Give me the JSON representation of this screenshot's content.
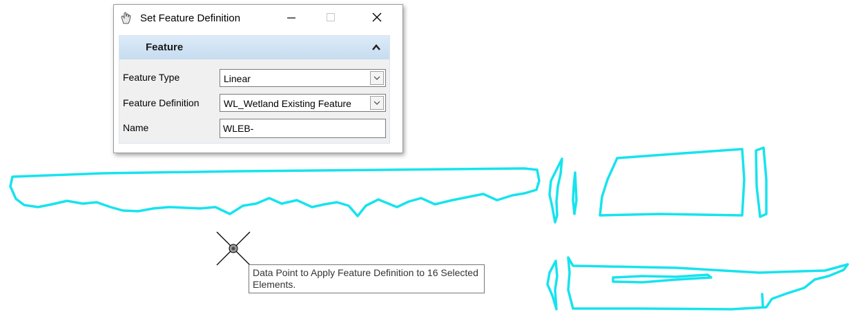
{
  "dialog": {
    "title": "Set Feature Definition",
    "window_buttons": {
      "minimize": "minimize-icon",
      "maximize": "maximize-icon",
      "close": "close-icon"
    },
    "panel": {
      "title": "Feature",
      "collapse_icon": "chevron-up-icon",
      "fields": {
        "feature_type": {
          "label": "Feature Type",
          "value": "Linear"
        },
        "feature_definition": {
          "label": "Feature Definition",
          "value": "WL_Wetland Existing Feature"
        },
        "name": {
          "label": "Name",
          "value": "WLEB-"
        }
      }
    }
  },
  "tooltip": {
    "text": "Data Point to Apply Feature Definition to 16 Selected Elements."
  },
  "colors": {
    "selection_outline": "#16e3ee",
    "panel_header": "#cfe3f5",
    "dialog_bg": "#f0f0f0"
  },
  "cursor_icon": "crosshair-cursor-icon"
}
